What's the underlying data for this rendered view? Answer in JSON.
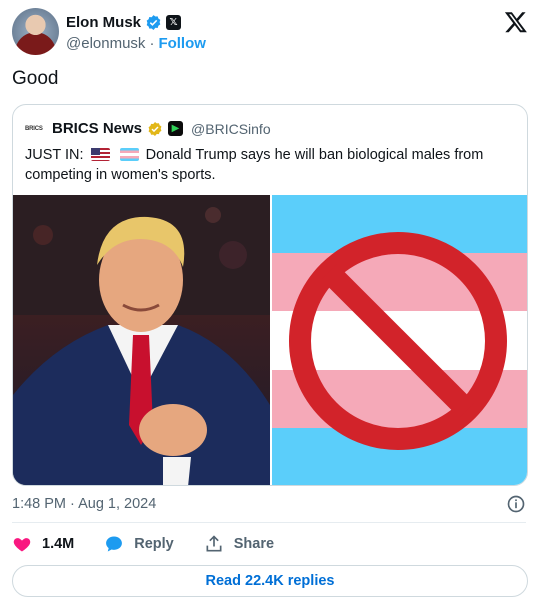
{
  "author": {
    "name": "Elon Musk",
    "handle": "@elonmusk",
    "separator": "·",
    "follow_label": "Follow"
  },
  "tweet": {
    "text": "Good",
    "timestamp": "1:48 PM · Aug 1, 2024"
  },
  "quote": {
    "logo_text": "BRICS",
    "name": "BRICS News",
    "handle": "@BRICSinfo",
    "text_prefix": "JUST IN:",
    "text_body": "Donald Trump says he will ban biological males from competing in women's sports."
  },
  "actions": {
    "likes": "1.4M",
    "reply_label": "Reply",
    "share_label": "Share"
  },
  "read_replies_label": "Read 22.4K replies",
  "colors": {
    "accent": "#1d9bf0",
    "like": "#f91880",
    "prohibit": "#d2232a"
  }
}
